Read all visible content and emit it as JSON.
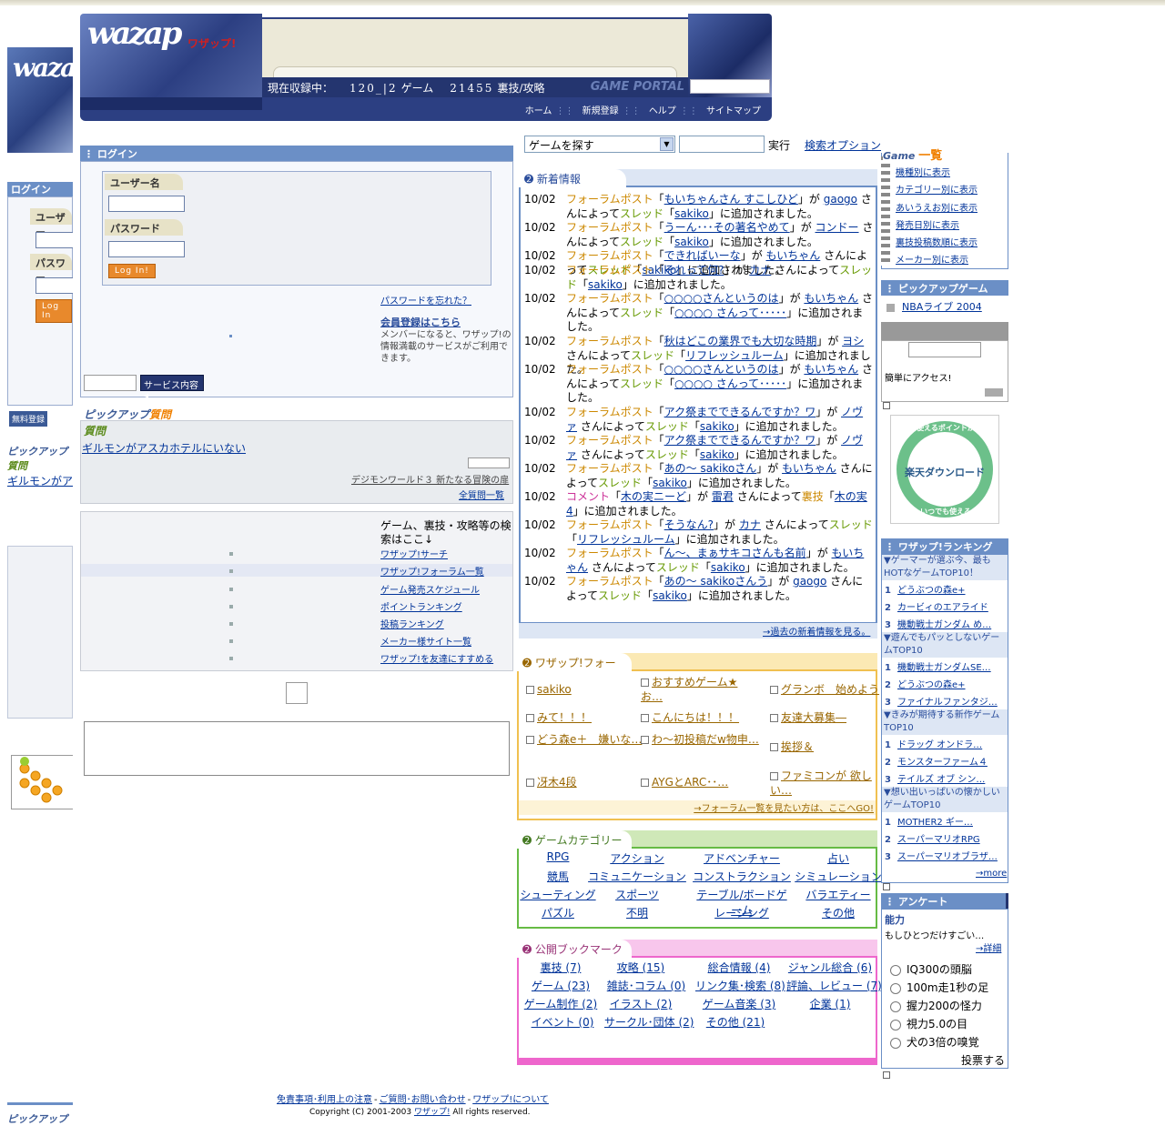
{
  "header": {
    "logo_text": "wazap",
    "logo_sub": "ワザップ!",
    "stats_label": "現在収録中：",
    "game_count": "120_|2",
    "game_unit": "ゲーム",
    "cheat_count": "21455",
    "cheat_unit": "裏技/攻略",
    "portal": "GAME PORTAL",
    "nav": [
      "ホーム",
      "新規登録",
      "ヘルプ",
      "サイトマップ"
    ]
  },
  "login": {
    "title": "ログイン",
    "user_label": "ユーザー名",
    "pass_label": "パスワード",
    "login_button": "Log In!",
    "forgot": "パスワードを忘れた？",
    "register_title": "会員登録はこちら",
    "register_text": "メンバーになると、ワザップ!の情報満載のサービスがご利用できます。",
    "service_button": "サービス内容"
  },
  "pickup_question": {
    "title_a": "ピックアップ",
    "title_b": "質問",
    "label": "質問",
    "question": "ギルモンがアスカホテルにいない",
    "game": "デジモンワールド３ 新たなる冒険の扉",
    "all_link": "全質問一覧"
  },
  "menu": {
    "intro": "ゲーム、裏技・攻略等の検索はここ↓",
    "items": [
      "ワザップ!サーチ",
      "ワザップ!フォーラム一覧",
      "ゲーム発売スケジュール",
      "ポイントランキング",
      "投稿ランキング",
      "メーカー様サイト一覧",
      "ワザップ!を友達にすすめる"
    ]
  },
  "search": {
    "select_value": "ゲームを探す",
    "go": "実行",
    "option": "検索オプション"
  },
  "news": {
    "title": "新着情報",
    "more": "→過去の新着情報を見る。",
    "items": [
      {
        "date": "10/02",
        "type": "フォーラムポスト",
        "title": "もいちゃんさん すこしひど",
        "user": "gaogo",
        "where": "スレッド",
        "thread": "sakiko"
      },
      {
        "date": "10/02",
        "type": "フォーラムポスト",
        "title": "うーん･･･その著名やめて",
        "user": "コンドー",
        "where": "スレッド",
        "thread": "sakiko"
      },
      {
        "date": "10/02",
        "type": "フォーラムポスト",
        "title": "できればいーな",
        "user": "もいちゃん",
        "where": "スレッド",
        "thread": "sakiko"
      },
      {
        "date": "10/02",
        "type": "フォーラムポスト",
        "title": "それって何?",
        "user": "カナ",
        "where": "スレッド",
        "thread": "sakiko"
      },
      {
        "date": "10/02",
        "type": "フォーラムポスト",
        "title": "○○○○さんというのは",
        "user": "もいちゃん",
        "where": "スレッド",
        "thread": "○○○○ さんって･････"
      },
      {
        "date": "10/02",
        "type": "フォーラムポスト",
        "title": "秋はどこの業界でも大切な時期",
        "user": "ヨシ",
        "where": "スレッド",
        "thread": "リフレッシュルーム"
      },
      {
        "date": "10/02",
        "type": "フォーラムポスト",
        "title": "○○○○さんというのは",
        "user": "もいちゃん",
        "where": "スレッド",
        "thread": "○○○○ さんって･････"
      },
      {
        "date": "10/02",
        "type": "フォーラムポスト",
        "title": "アク祭までできるんですか？ワ",
        "user": "ノヴァ",
        "where": "スレッド",
        "thread": "sakiko"
      },
      {
        "date": "10/02",
        "type": "フォーラムポスト",
        "title": "アク祭までできるんですか？ワ",
        "user": "ノヴァ",
        "where": "スレッド",
        "thread": "sakiko"
      },
      {
        "date": "10/02",
        "type": "フォーラムポスト",
        "title": "あの～ sakikoさん",
        "user": "もいちゃん",
        "where": "スレッド",
        "thread": "sakiko"
      },
      {
        "date": "10/02",
        "type": "コメント",
        "title": "木の実ニーど",
        "user": "雷君",
        "where": "裏技",
        "thread": "木の実4"
      },
      {
        "date": "10/02",
        "type": "フォーラムポスト",
        "title": "そうなん?",
        "user": "カナ",
        "where": "スレッド",
        "thread": "リフレッシュルーム"
      },
      {
        "date": "10/02",
        "type": "フォーラムポスト",
        "title": "ん～、まぁサキコさんも名前",
        "user": "もいちゃん",
        "where": "スレッド",
        "thread": "sakiko"
      },
      {
        "date": "10/02",
        "type": "フォーラムポスト",
        "title": "あの～ sakikoさんう",
        "user": "gaogo",
        "where": "スレッド",
        "thread": "sakiko"
      }
    ],
    "by": "が",
    "san": "さんによって",
    "added": "に追加されました。"
  },
  "forum": {
    "title": "ワザップ!フォーラム",
    "items": [
      "sakiko",
      "おすすめゲーム★お…",
      "グランボ　始めよう",
      "みて！！！",
      "こんにちは！！！",
      "友達大募集―",
      "どう森e＋　嫌いな…",
      "わ～初投稿だw物申…",
      "挨拶＆",
      "冴木4段",
      "AYGとARC･･…",
      "ファミコンが 欲しい…"
    ],
    "more": "→フォーラム一覧を見たい方は、ここへGO!"
  },
  "categories": {
    "title": "ゲームカテゴリー",
    "items": [
      "RPG",
      "アクション",
      "アドベンチャー",
      "占い",
      "競馬",
      "コミュニケーション",
      "コンストラクション",
      "シミュレーション",
      "シューティング",
      "スポーツ",
      "テーブル/ボードゲーム",
      "バラエティー",
      "パズル",
      "不明",
      "レーシング",
      "その他"
    ]
  },
  "bookmarks": {
    "title": "公開ブックマーク",
    "items": [
      "裏技 (7)",
      "攻略 (15)",
      "総合情報 (4)",
      "ジャンル総合 (6)",
      "ゲーム (23)",
      "雑誌･コラム (0)",
      "リンク集･検索 (8)",
      "評論、レビュー (7)",
      "ゲーム制作 (2)",
      "イラスト (2)",
      "ゲーム音楽 (3)",
      "企業 (1)",
      "イベント (0)",
      "サークル･団体 (2)",
      "その他 (21)"
    ]
  },
  "gamelist": {
    "title_a": "Game",
    "title_b": "一覧",
    "items": [
      "機種別に表示",
      "カテゴリー別に表示",
      "あいうえお別に表示",
      "発売日別に表示",
      "裏技投稿数順に表示",
      "メーカー別に表示"
    ]
  },
  "pickup_game": {
    "title": "ピックアップゲーム",
    "item": "NBAライブ 2004"
  },
  "access": {
    "text": "簡単にアクセス!"
  },
  "rakuten": {
    "main": "楽天ダウンロード",
    "top": "すぐ使えるポイントが貯まる!",
    "bottom": "いつでも使える"
  },
  "ranking": {
    "title": "ワザップ!ランキング",
    "sections": [
      {
        "title": "▼ゲーマーが選ぶ今、最もHOTなゲームTOP10！",
        "items": [
          "どうぶつの森e+",
          "カービィのエアライド",
          "機動戦士ガンダム め…"
        ]
      },
      {
        "title": "▼遊んでもパッとしないゲームTOP10",
        "items": [
          "機動戦士ガンダムSE…",
          "どうぶつの森e+",
          "ファイナルファンタジ…"
        ]
      },
      {
        "title": "▼きみが期待する新作ゲームTOP10",
        "items": [
          "ドラッグ オンドラ…",
          "モンスターファーム４",
          "テイルズ オブ シン…"
        ]
      },
      {
        "title": "▼想い出いっぱいの懐かしいゲームTOP10",
        "items": [
          "MOTHER2 ギー…",
          "スーパーマリオRPG",
          "スーパーマリオブラザ…"
        ]
      }
    ],
    "more": "→more"
  },
  "survey": {
    "title": "アンケート",
    "topic": "能力",
    "question": "もしひとつだけすごい…",
    "detail": "→詳細",
    "options": [
      "IQ300の頭脳",
      "100m走1秒の足",
      "握力200の怪力",
      "視力5.0の目",
      "犬の3倍の嗅覚"
    ],
    "vote": "投票する"
  },
  "footer": {
    "links": [
      "免責事項･利用上の注意",
      "ご質問･お問い合わせ",
      "ワザップ!について"
    ],
    "copyright_a": "Copyright (C) 2001-2003",
    "copyright_link": "ワザップ!",
    "copyright_b": "All rights reserved."
  },
  "ghost": {
    "login": "ログイン",
    "user": "ユーザー",
    "pass": "パスワー",
    "login_btn": "Log In",
    "free": "無料登録",
    "pick": "ピックアップ",
    "q": "質問",
    "qtext": "ギルモンがア",
    "pick2": "ピックアップ"
  },
  "colors": {
    "accent": "#6b8fc6",
    "navy": "#24356f",
    "forum": "#f0c050",
    "category": "#66bb44",
    "bookmark": "#ee66cc"
  }
}
